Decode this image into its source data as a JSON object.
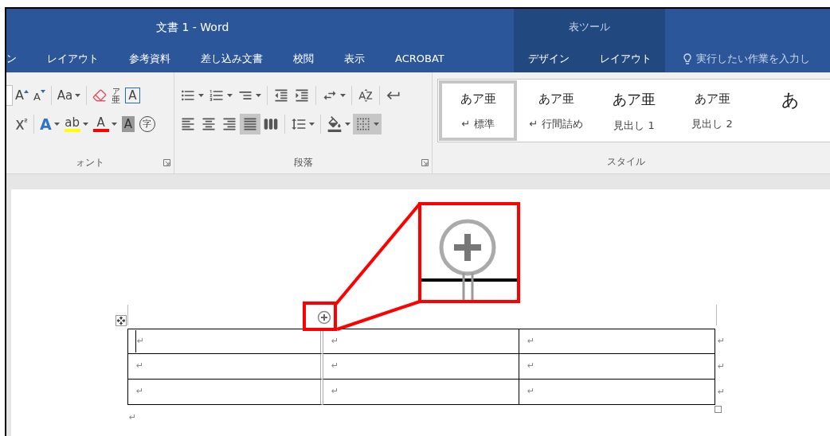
{
  "window": {
    "title": "文書 1 - Word"
  },
  "tabs": [
    {
      "label": "ン",
      "selected": false
    },
    {
      "label": "レイアウト",
      "selected": false
    },
    {
      "label": "参考資料",
      "selected": false
    },
    {
      "label": "差し込み文書",
      "selected": false
    },
    {
      "label": "校閲",
      "selected": false
    },
    {
      "label": "表示",
      "selected": false
    },
    {
      "label": "ACROBAT",
      "selected": false
    }
  ],
  "contextual_tabs": {
    "header": "表ツール",
    "tabs": [
      {
        "label": "デザイン",
        "selected": false
      },
      {
        "label": "レイアウト",
        "selected": false
      }
    ]
  },
  "tell_me": {
    "placeholder": "実行したい作業を入力し"
  },
  "ribbon": {
    "font_group": {
      "label": "ォント",
      "rows": [
        [
          {
            "kind": "size-field"
          },
          {
            "kind": "grow",
            "label": "A",
            "selected": false
          },
          {
            "kind": "shrink",
            "label": "A",
            "selected": false
          },
          {
            "kind": "separator"
          },
          {
            "kind": "case",
            "label": "Aa",
            "dropdown": true,
            "selected": false
          },
          {
            "kind": "separator"
          },
          {
            "kind": "clear",
            "selected": false
          },
          {
            "kind": "phonetic",
            "label": "ア",
            "sub": "亜",
            "selected": false
          },
          {
            "kind": "boxed",
            "label": "A",
            "selected": false
          }
        ],
        [
          {
            "kind": "superscript",
            "selected": false
          },
          {
            "kind": "separator"
          },
          {
            "kind": "effects",
            "label": "A",
            "dropdown": true,
            "selected": false
          },
          {
            "kind": "highlight",
            "label": "ab",
            "dropdown": true,
            "color": "#ffff00",
            "selected": false
          },
          {
            "kind": "font-color",
            "label": "A",
            "dropdown": true,
            "color": "#ff0000",
            "selected": false
          },
          {
            "kind": "shaded",
            "label": "A",
            "selected": false
          },
          {
            "kind": "enclosed",
            "label": "字",
            "selected": false
          }
        ]
      ]
    },
    "paragraph_group": {
      "label": "段落",
      "rows": [
        [
          {
            "kind": "bullets",
            "dropdown": true,
            "selected": false
          },
          {
            "kind": "numbering",
            "dropdown": true,
            "selected": false
          },
          {
            "kind": "multilevel",
            "dropdown": true,
            "selected": false
          },
          {
            "kind": "separator"
          },
          {
            "kind": "outdent",
            "selected": false
          },
          {
            "kind": "indent",
            "selected": false
          },
          {
            "kind": "separator"
          },
          {
            "kind": "asian-layout",
            "dropdown": true,
            "selected": false
          },
          {
            "kind": "separator"
          },
          {
            "kind": "sort",
            "selected": false
          },
          {
            "kind": "separator"
          },
          {
            "kind": "marks",
            "selected": false
          }
        ],
        [
          {
            "kind": "align-left",
            "selected": false
          },
          {
            "kind": "align-center",
            "selected": false
          },
          {
            "kind": "align-right",
            "selected": false
          },
          {
            "kind": "justify",
            "selected": true
          },
          {
            "kind": "distributed",
            "selected": false
          },
          {
            "kind": "separator"
          },
          {
            "kind": "line-spacing",
            "dropdown": true,
            "selected": false
          },
          {
            "kind": "separator"
          },
          {
            "kind": "shading",
            "dropdown": true,
            "selected": false
          },
          {
            "kind": "borders",
            "dropdown": true,
            "selected": true
          }
        ]
      ]
    },
    "styles_group": {
      "label": "スタイル",
      "styles": [
        {
          "sample": "あア亜",
          "name": "↵ 標準",
          "selected": true
        },
        {
          "sample": "あア亜",
          "name": "↵ 行間詰め",
          "selected": false
        },
        {
          "sample": "あア亜",
          "name": "見出し 1",
          "selected": false
        },
        {
          "sample": "あア亜",
          "name": "見出し 2",
          "selected": false
        },
        {
          "sample": "あ",
          "selected": false
        }
      ]
    }
  },
  "document": {
    "table": {
      "rows": [
        [
          "↵",
          "↵",
          "↵"
        ],
        [
          "↵",
          "↵",
          "↵"
        ],
        [
          "↵",
          "↵",
          "↵"
        ]
      ],
      "row_end_marks": [
        "↵",
        "↵",
        "↵"
      ]
    },
    "paragraph_mark": "↵"
  }
}
